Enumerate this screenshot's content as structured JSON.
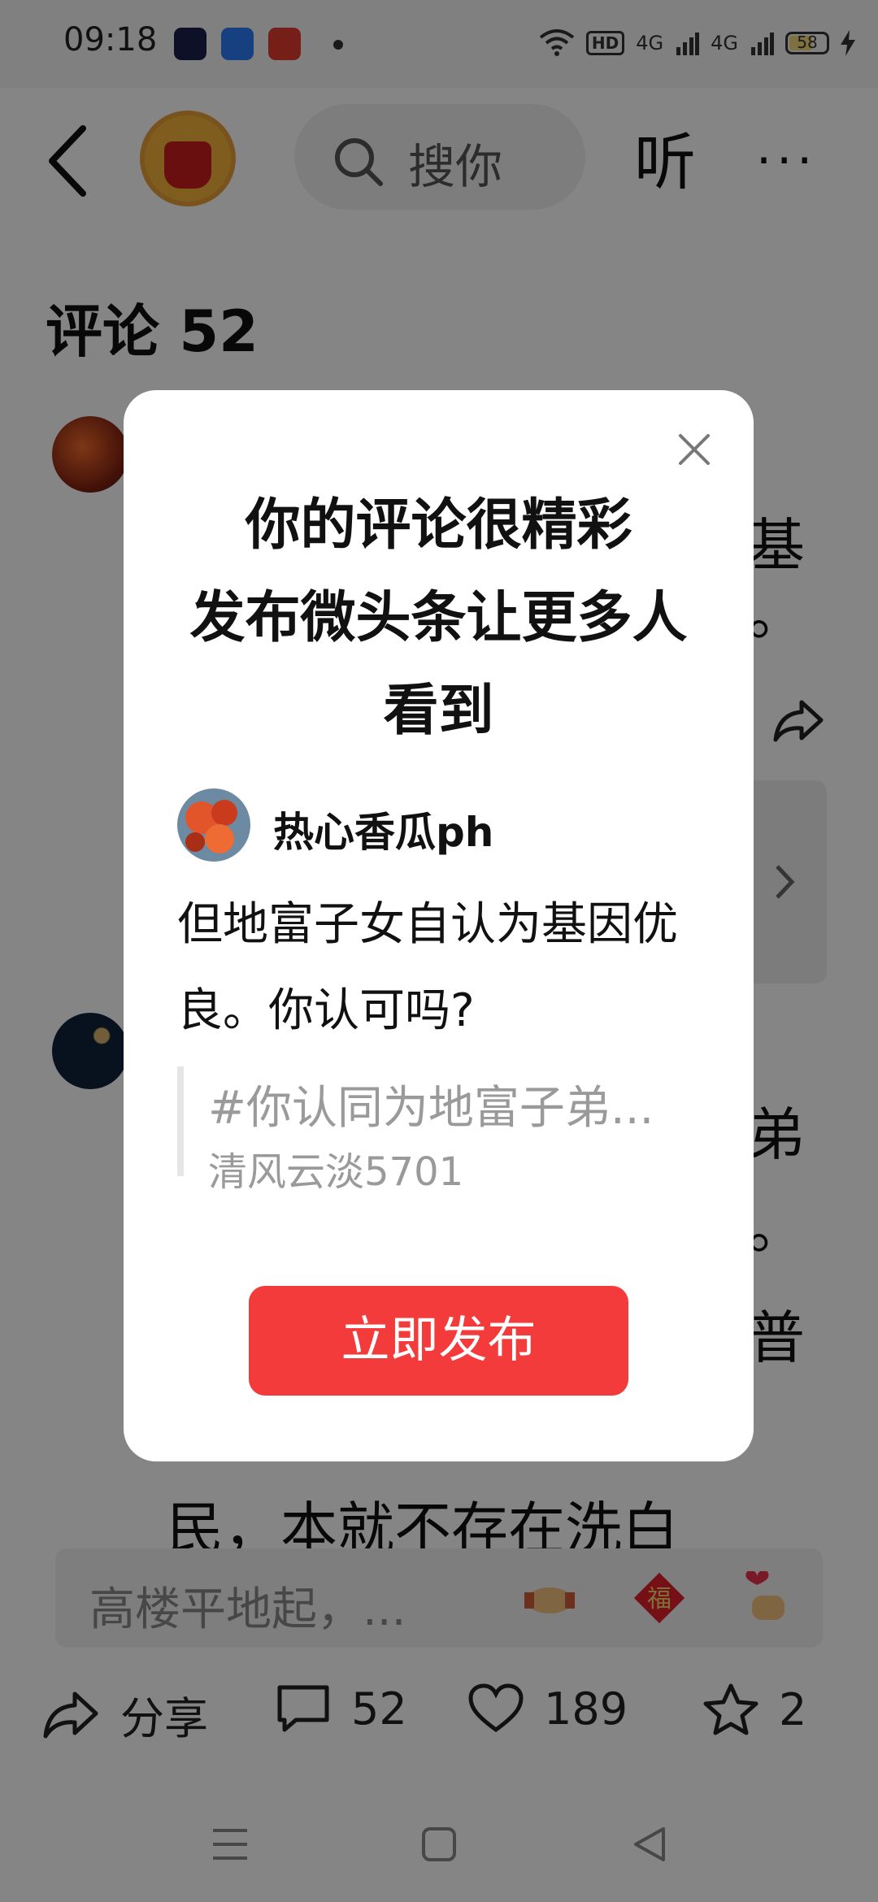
{
  "status_bar": {
    "time": "09:18",
    "network": "4G",
    "network2": "4G",
    "battery": "58",
    "icons": [
      "app-icon",
      "browser-icon",
      "toutiao-icon",
      "wifi-icon",
      "hd-icon",
      "signal-icon",
      "charging-icon"
    ]
  },
  "header": {
    "search_placeholder": "搜你",
    "listen_label": "听",
    "more_label": "···"
  },
  "comments": {
    "title": "评论 52",
    "background_fragments": [
      "基",
      "。",
      "弟",
      "。",
      "普",
      "民，本就不存在洗白"
    ]
  },
  "modal": {
    "title_line1": "你的评论很精彩",
    "title_line2": "发布微头条让更多人",
    "title_line3": "看到",
    "username": "热心香瓜ph",
    "comment_text": "但地富子女自认为基因优良。你认可吗?",
    "quote_topic": "#你认同为地富子弟...",
    "quote_author": "清风云淡5701",
    "publish_button": "立即发布"
  },
  "input_bar": {
    "placeholder": "高楼平地起，...",
    "emoji": [
      "handshake-emoji",
      "fu-emoji",
      "heart-hand-emoji"
    ],
    "fu_char": "福"
  },
  "action_bar": {
    "share_label": "分享",
    "comment_count": "52",
    "like_count": "189",
    "favorite_count": "2"
  },
  "colors": {
    "accent": "#f43b3b",
    "overlay": "rgba(0,0,0,0.48)"
  }
}
